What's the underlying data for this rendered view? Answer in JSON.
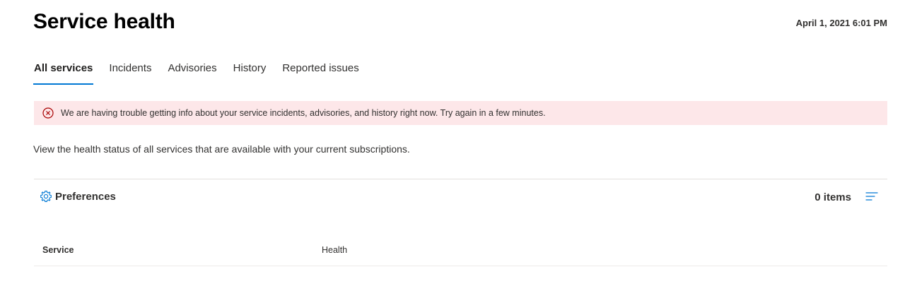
{
  "header": {
    "title": "Service health",
    "timestamp": "April 1, 2021 6:01 PM"
  },
  "tabs": [
    {
      "label": "All services",
      "active": true
    },
    {
      "label": "Incidents",
      "active": false
    },
    {
      "label": "Advisories",
      "active": false
    },
    {
      "label": "History",
      "active": false
    },
    {
      "label": "Reported issues",
      "active": false
    }
  ],
  "error": {
    "icon": "error-circle-icon",
    "message": "We are having trouble getting info about your service incidents, advisories, and history right now. Try again in a few minutes."
  },
  "description": "View the health status of all services that are available with your current subscriptions.",
  "toolbar": {
    "preferences_label": "Preferences",
    "preferences_icon": "gear-icon",
    "item_count": "0 items",
    "filter_icon": "filter-lines-icon"
  },
  "table": {
    "columns": [
      "Service",
      "Health"
    ],
    "rows": []
  },
  "colors": {
    "accent": "#0078d4",
    "error_bg": "#fde7e9",
    "error_icon": "#a80000"
  }
}
